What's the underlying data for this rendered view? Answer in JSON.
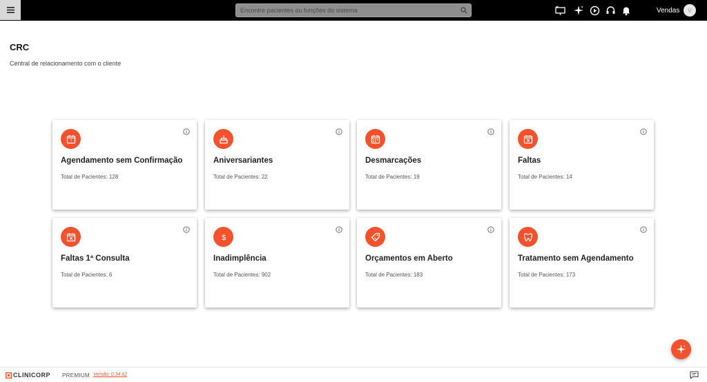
{
  "search": {
    "placeholder": "Encontre pacientes ou funções do sistema"
  },
  "header": {
    "user_name": "Vendas",
    "avatar_initial": "V"
  },
  "page": {
    "title": "CRC",
    "subtitle": "Central de relacionamento com o cliente"
  },
  "cards": [
    {
      "title": "Agendamento sem Confirmação",
      "total": "Total de Pacientes: 128",
      "icon": "calendar-check-icon"
    },
    {
      "title": "Aniversariantes",
      "total": "Total de Pacientes: 22",
      "icon": "cake-icon"
    },
    {
      "title": "Desmarcações",
      "total": "Total de Pacientes: 19",
      "icon": "calendar-grid-icon"
    },
    {
      "title": "Faltas",
      "total": "Total de Pacientes: 14",
      "icon": "calendar-x-icon"
    },
    {
      "title": "Faltas 1ª Consulta",
      "total": "Total de Pacientes: 6",
      "icon": "calendar-x-icon"
    },
    {
      "title": "Inadimplência",
      "total": "Total de Pacientes: 902",
      "icon": "dollar-icon"
    },
    {
      "title": "Orçamentos em Aberto",
      "total": "Total de Pacientes: 183",
      "icon": "price-tag-icon"
    },
    {
      "title": "Tratamento sem Agendamento",
      "total": "Total de Pacientes: 173",
      "icon": "tooth-icon"
    }
  ],
  "footer": {
    "brand": "CLINICORP",
    "plan": "PREMIUM",
    "version": "Versão: 0.34.62"
  },
  "colors": {
    "accent": "#f4522d",
    "topbar": "#000000"
  }
}
